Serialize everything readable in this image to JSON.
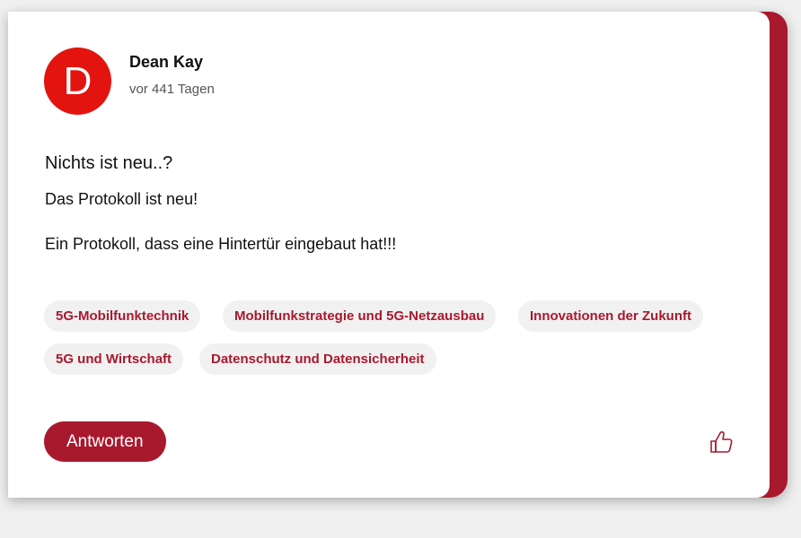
{
  "post": {
    "author": {
      "initial": "D",
      "name": "Dean Kay",
      "avatar_color": "#e3130f"
    },
    "timestamp": "vor 441 Tagen",
    "title": "Nichts ist neu..?",
    "body": [
      "Das Protokoll ist neu!",
      "Ein Protokoll, dass eine Hintertür eingebaut hat!!!"
    ],
    "tags": [
      "5G-Mobilfunktechnik",
      "Mobilfunkstrategie und 5G-Netzausbau",
      "Innovationen der Zukunft",
      "5G und Wirtschaft",
      "Datenschutz und Datensicherheit"
    ],
    "reply_label": "Antworten",
    "like_icon": "thumbs-up-icon"
  },
  "colors": {
    "accent": "#a8192e",
    "tag_background": "#f1f1f1"
  }
}
